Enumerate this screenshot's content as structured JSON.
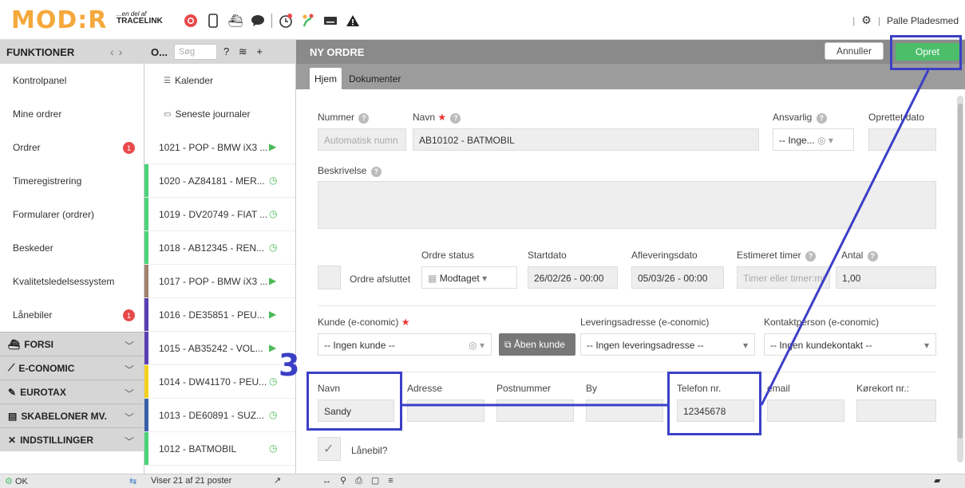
{
  "brand": {
    "logo": "MOD:R",
    "sub1": "...en del af",
    "sub2": "TRACELINK"
  },
  "topbar": {
    "icons": [
      "lifebuoy-icon",
      "phone-icon",
      "ship-icon",
      "chat-icon",
      "clock-icon",
      "leaf-icon",
      "keyboard-icon",
      "warning-icon"
    ],
    "settings_icon": "gear-icon",
    "user": "Palle Pladesmed"
  },
  "sidebar": {
    "title": "FUNKTIONER",
    "items": [
      {
        "label": "Kontrolpanel",
        "badge": ""
      },
      {
        "label": "Mine ordrer",
        "badge": ""
      },
      {
        "label": "Ordrer",
        "badge": "1"
      },
      {
        "label": "Timeregistrering",
        "badge": ""
      },
      {
        "label": "Formularer (ordrer)",
        "badge": ""
      },
      {
        "label": "Beskeder",
        "badge": ""
      },
      {
        "label": "Kvalitetsledelsessystem",
        "badge": ""
      },
      {
        "label": "Lånebiler",
        "badge": "1"
      }
    ],
    "groups": [
      {
        "icon": "ship-icon",
        "label": "FORSI"
      },
      {
        "icon": "chart-icon",
        "label": "E-CONOMIC"
      },
      {
        "icon": "wrench-icon",
        "label": "EUROTAX"
      },
      {
        "icon": "template-icon",
        "label": "SKABELONER MV."
      },
      {
        "icon": "tools-icon",
        "label": "INDSTILLINGER"
      }
    ]
  },
  "list": {
    "title": "O...",
    "search_placeholder": "Søg",
    "top_items": [
      "Kalender",
      "Seneste journaler"
    ],
    "rows": [
      {
        "label": "1021 - POP - BMW iX3 ...",
        "color": "#ffffff",
        "status": "play"
      },
      {
        "label": "1020 - AZ84181 - MER...",
        "color": "#4cd37a",
        "status": "clock"
      },
      {
        "label": "1019 - DV20749 - FIAT ...",
        "color": "#4cd37a",
        "status": "clock"
      },
      {
        "label": "1018 - AB12345 - REN...",
        "color": "#4cd37a",
        "status": "clock"
      },
      {
        "label": "1017 - POP - BMW iX3 ...",
        "color": "#a0826d",
        "status": "play"
      },
      {
        "label": "1016 - DE35851 - PEU...",
        "color": "#5a3fb3",
        "status": "play"
      },
      {
        "label": "1015 - AB35242 - VOL...",
        "color": "#5a3fb3",
        "status": "play"
      },
      {
        "label": "1014 - DW41170 - PEU...",
        "color": "#f5d020",
        "status": "clock"
      },
      {
        "label": "1013 - DE60891 - SUZ...",
        "color": "#3b5fa8",
        "status": "clock"
      },
      {
        "label": "1012 - BATMOBIL",
        "color": "#4cd37a",
        "status": "clock"
      }
    ]
  },
  "main": {
    "title": "NY ORDRE",
    "cancel": "Annuller",
    "create": "Opret",
    "tabs": [
      "Hjem",
      "Dokumenter"
    ]
  },
  "form": {
    "nummer_label": "Nummer",
    "nummer_placeholder": "Automatisk numn",
    "navn_label": "Navn",
    "navn_value": "AB10102 - BATMOBIL",
    "ansvarlig_label": "Ansvarlig",
    "ansvarlig_value": "-- Inge...",
    "oprettet_label": "Oprettet dato",
    "beskrivelse_label": "Beskrivelse",
    "ordre_afsluttet_label": "Ordre afsluttet",
    "ordre_status_label": "Ordre status",
    "ordre_status_value": "Modtaget",
    "startdato_label": "Startdato",
    "startdato_value": "26/02/26 - 00:00",
    "afleveringsdato_label": "Afleveringsdato",
    "afleveringsdato_value": "05/03/26 - 00:00",
    "estimeret_label": "Estimeret timer",
    "estimeret_placeholder": "Timer eller timer:mi",
    "antal_label": "Antal",
    "antal_value": "1,00",
    "kunde_label": "Kunde (e-conomic)",
    "kunde_value": "-- Ingen kunde --",
    "aaben_kunde": "Åben kunde",
    "lev_label": "Leveringsadresse (e-conomic)",
    "lev_value": "-- Ingen leveringsadresse --",
    "kontakt_label": "Kontaktperson (e-conomic)",
    "kontakt_value": "-- Ingen kundekontakt --",
    "k_navn_label": "Navn",
    "k_navn_value": "Sandy",
    "adresse_label": "Adresse",
    "postnr_label": "Postnummer",
    "by_label": "By",
    "telefon_label": "Telefon nr.",
    "telefon_value": "12345678",
    "email_label": "email",
    "korekort_label": "Kørekort nr.:",
    "laanebil_label": "Lånebil?"
  },
  "annotation": {
    "number": "3",
    "color": "#3b3fc6"
  },
  "status": {
    "ok": "OK",
    "count": "Viser 21 af 21 poster"
  }
}
